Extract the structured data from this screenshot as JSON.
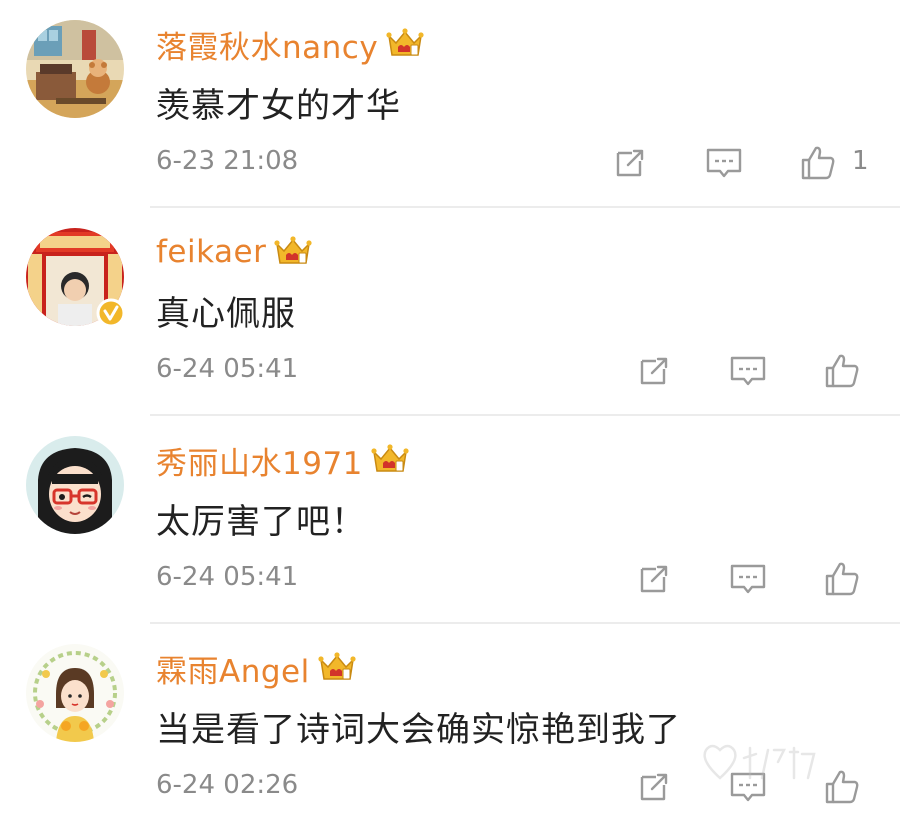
{
  "comments": [
    {
      "username": "落霞秋水nancy",
      "text": "羡慕才女的才华",
      "timestamp": "6-23 21:08",
      "likes": "1",
      "avatar_icon": "avatar-illustration-room-cat",
      "badge_level": "vip-crown-badge"
    },
    {
      "username": "feikaer",
      "text": "真心佩服",
      "timestamp": "6-24 05:41",
      "likes": "",
      "avatar_icon": "avatar-couplet-verified",
      "badge_level": "vip-crown-badge"
    },
    {
      "username": "秀丽山水1971",
      "text": "太厉害了吧！",
      "timestamp": "6-24 05:41",
      "likes": "",
      "avatar_icon": "avatar-cartoon-girl-glasses",
      "badge_level": "vip-crown-badge"
    },
    {
      "username": "霖雨Angel",
      "text": "当是看了诗词大会确实惊艳到我了",
      "timestamp": "6-24 02:26",
      "likes": "",
      "avatar_icon": "avatar-girl-flower-wreath",
      "badge_level": "vip-crown-badge"
    }
  ],
  "colors": {
    "username": "#e8832f",
    "text": "#222222",
    "meta": "#8a8a8a",
    "icon": "#9a9a9a",
    "divider": "#ececec",
    "crown": "#f2b72a"
  }
}
